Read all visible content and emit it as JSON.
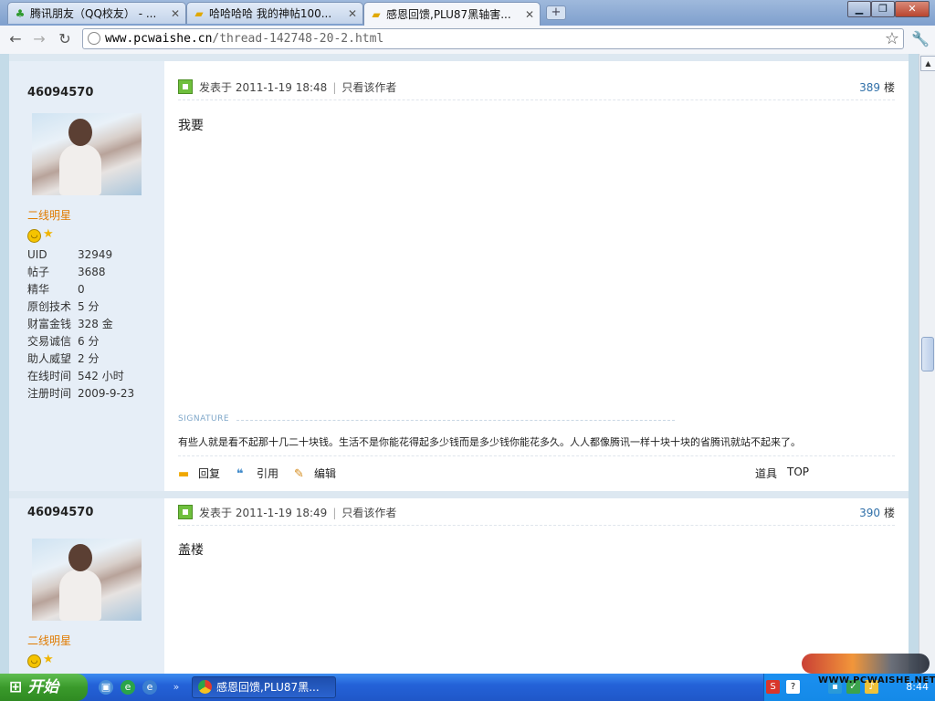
{
  "browser": {
    "tabs": [
      {
        "title": "腾讯朋友（QQ校友） - ...",
        "icon": "clover-icon"
      },
      {
        "title": "哈哈哈哈 我的神帖100...",
        "icon": "trophy-icon"
      },
      {
        "title": "感恩回馈,PLU87黑轴害...",
        "icon": "trophy-icon",
        "active": true
      }
    ],
    "url_host": "www.pcwaishe.cn",
    "url_path": "/thread-142748-20-2.html"
  },
  "posts": [
    {
      "username": "46094570",
      "rank": "二线明星",
      "stats": [
        {
          "k": "UID",
          "v": "32949"
        },
        {
          "k": "帖子",
          "v": "3688"
        },
        {
          "k": "精华",
          "v": "0"
        },
        {
          "k": "原创技术",
          "v": "5 分"
        },
        {
          "k": "财富金钱",
          "v": "328 金"
        },
        {
          "k": "交易诚信",
          "v": "6 分"
        },
        {
          "k": "助人威望",
          "v": "2 分"
        },
        {
          "k": "在线时间",
          "v": "542 小时"
        },
        {
          "k": "注册时间",
          "v": "2009-9-23"
        }
      ],
      "posted": "发表于 2011-1-19 18:48",
      "only_author": "只看该作者",
      "floor_num": "389",
      "floor_unit": "楼",
      "content": "我要",
      "signature_title": "SIGNATURE",
      "signature": "有些人就是看不起那十几二十块钱。生活不是你能花得起多少钱而是多少钱你能花多久。人人都像腾讯一样十块十块的省腾讯就站不起来了。",
      "actions": {
        "reply": "回复",
        "quote": "引用",
        "edit": "编辑",
        "tools": "道具",
        "top": "TOP"
      }
    },
    {
      "username": "46094570",
      "rank": "二线明星",
      "posted": "发表于 2011-1-19 18:49",
      "only_author": "只看该作者",
      "floor_num": "390",
      "floor_unit": "楼",
      "content": "盖楼"
    }
  ],
  "taskbar": {
    "start": "开始",
    "task": "感恩回馈,PLU87黑...",
    "clock": "8:44",
    "watermark": "WWW.PCWAISHE.NET"
  },
  "colors": {
    "rank": "#e07b00",
    "floor_num": "#2f6fa8",
    "page_bg": "#c4dbe8",
    "sidebar": "#e6eef7"
  }
}
